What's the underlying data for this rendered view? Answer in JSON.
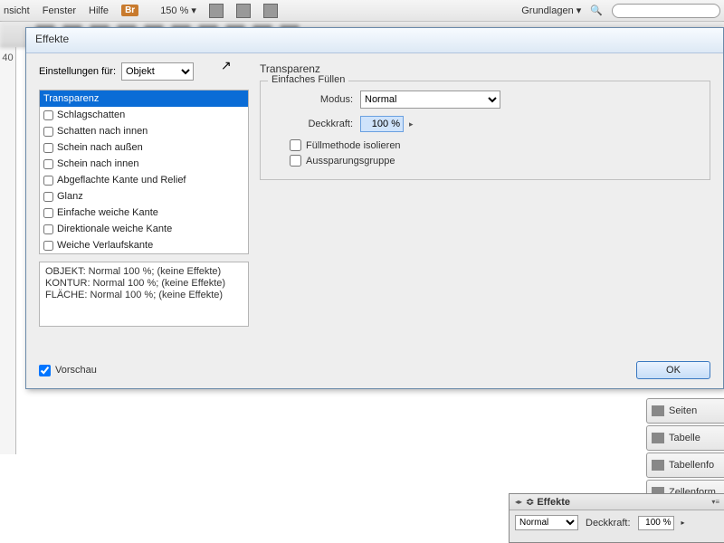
{
  "menubar": {
    "items": [
      "nsicht",
      "Fenster",
      "Hilfe"
    ],
    "br": "Br",
    "zoom": "150 %  ▾",
    "workspace": "Grundlagen  ▾"
  },
  "dialog": {
    "title": "Effekte",
    "settings_label": "Einstellungen für:",
    "settings_value": "Objekt",
    "effects": [
      "Transparenz",
      "Schlagschatten",
      "Schatten nach innen",
      "Schein nach außen",
      "Schein nach innen",
      "Abgeflachte Kante und Relief",
      "Glanz",
      "Einfache weiche Kante",
      "Direktionale weiche Kante",
      "Weiche Verlaufskante"
    ],
    "summary": [
      "OBJEKT: Normal 100 %; (keine Effekte)",
      "KONTUR: Normal 100 %; (keine Effekte)",
      "FLÄCHE: Normal 100 %; (keine Effekte)"
    ],
    "right_heading": "Transparenz",
    "fieldset_label": "Einfaches Füllen",
    "mode_label": "Modus:",
    "mode_value": "Normal",
    "opacity_label": "Deckkraft:",
    "opacity_value": "100 %",
    "isolate": "Füllmethode isolieren",
    "knockout": "Aussparungsgruppe",
    "preview": "Vorschau",
    "ok": "OK"
  },
  "panels": {
    "items": [
      "Seiten",
      "Tabelle",
      "Tabellenfo",
      "Zellenform"
    ]
  },
  "effects_panel": {
    "title": "Effekte",
    "mode": "Normal",
    "opacity_label": "Deckkraft:",
    "opacity_value": "100 %"
  },
  "ruler_tick": "40"
}
